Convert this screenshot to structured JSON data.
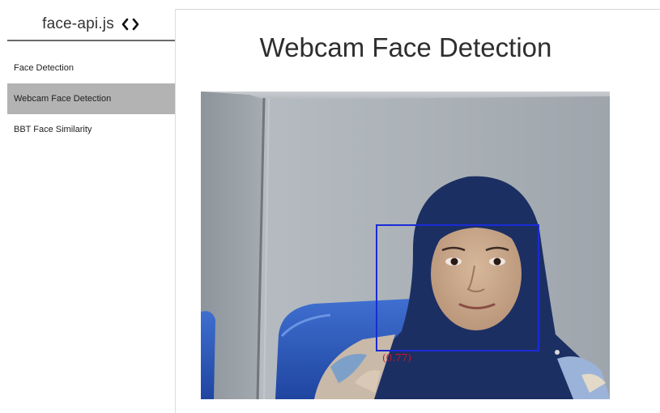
{
  "sidebar": {
    "brand": "face-api.js",
    "brand_icon": "code-brackets-icon",
    "items": [
      {
        "label": "Face Detection",
        "active": false
      },
      {
        "label": "Webcam Face Detection",
        "active": true
      },
      {
        "label": "BBT Face Similarity",
        "active": false
      }
    ]
  },
  "main": {
    "title": "Webcam Face Detection"
  },
  "detection": {
    "score_label": "(0.77)",
    "box_color": "#1a2bd6",
    "score_color": "#c8182a"
  },
  "colors": {
    "active_nav_bg": "#b3b3b3",
    "header_rule": "#6b6b6b"
  }
}
